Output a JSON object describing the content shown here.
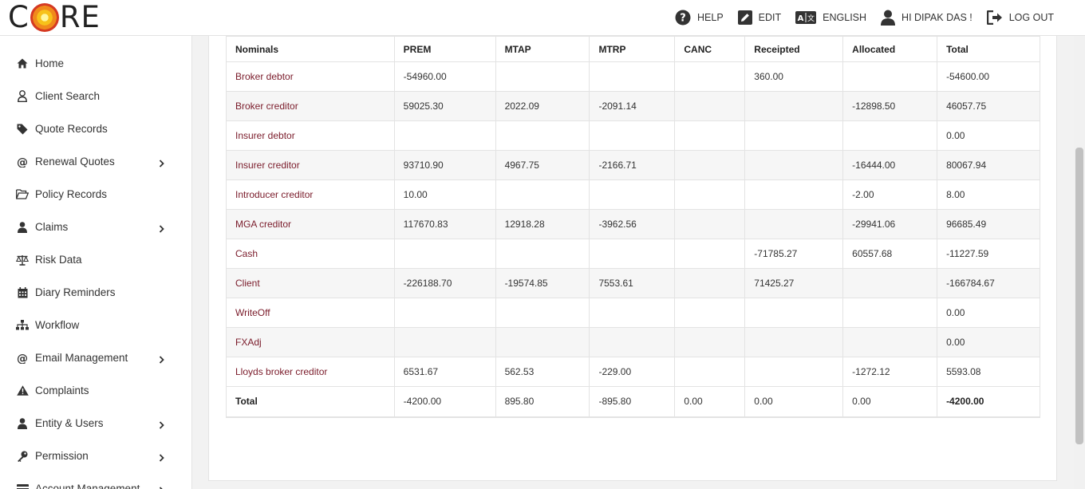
{
  "brand": {
    "left": "C",
    "right": "RE"
  },
  "topnav": [
    {
      "label": "HELP",
      "icon": "help-icon"
    },
    {
      "label": "EDIT",
      "icon": "edit-icon"
    },
    {
      "label": "ENGLISH",
      "icon": "translate-icon"
    },
    {
      "label": "HI DIPAK DAS !",
      "icon": "user-icon"
    },
    {
      "label": "LOG OUT",
      "icon": "logout-icon"
    }
  ],
  "sidebar": {
    "items": [
      {
        "label": "Home",
        "icon": "home-icon",
        "has_chevron": false
      },
      {
        "label": "Client Search",
        "icon": "user-outline-icon",
        "has_chevron": false
      },
      {
        "label": "Quote Records",
        "icon": "tag-icon",
        "has_chevron": false
      },
      {
        "label": "Renewal Quotes",
        "icon": "at-icon",
        "has_chevron": true
      },
      {
        "label": "Policy Records",
        "icon": "folder-open-icon",
        "has_chevron": false
      },
      {
        "label": "Claims",
        "icon": "user-icon",
        "has_chevron": true
      },
      {
        "label": "Risk Data",
        "icon": "scale-icon",
        "has_chevron": false
      },
      {
        "label": "Diary Reminders",
        "icon": "calendar-icon",
        "has_chevron": false
      },
      {
        "label": "Workflow",
        "icon": "sitemap-icon",
        "has_chevron": false
      },
      {
        "label": "Email Management",
        "icon": "at-icon",
        "has_chevron": true
      },
      {
        "label": "Complaints",
        "icon": "warning-icon",
        "has_chevron": false
      },
      {
        "label": "Entity & Users",
        "icon": "user-icon",
        "has_chevron": true
      },
      {
        "label": "Permission",
        "icon": "key-icon",
        "has_chevron": true
      },
      {
        "label": "Account Management",
        "icon": "credit-card-icon",
        "has_chevron": true
      }
    ]
  },
  "table": {
    "headers": [
      "Nominals",
      "PREM",
      "MTAP",
      "MTRP",
      "CANC",
      "Receipted",
      "Allocated",
      "Total"
    ],
    "rows": [
      [
        "Broker debtor",
        "-54960.00",
        "",
        "",
        "",
        "360.00",
        "",
        "-54600.00"
      ],
      [
        "Broker creditor",
        "59025.30",
        "2022.09",
        "-2091.14",
        "",
        "",
        "-12898.50",
        "46057.75"
      ],
      [
        "Insurer debtor",
        "",
        "",
        "",
        "",
        "",
        "",
        "0.00"
      ],
      [
        "Insurer creditor",
        "93710.90",
        "4967.75",
        "-2166.71",
        "",
        "",
        "-16444.00",
        "80067.94"
      ],
      [
        "Introducer creditor",
        "10.00",
        "",
        "",
        "",
        "",
        "-2.00",
        "8.00"
      ],
      [
        "MGA creditor",
        "117670.83",
        "12918.28",
        "-3962.56",
        "",
        "",
        "-29941.06",
        "96685.49"
      ],
      [
        "Cash",
        "",
        "",
        "",
        "",
        "-71785.27",
        "60557.68",
        "-11227.59"
      ],
      [
        "Client",
        "-226188.70",
        "-19574.85",
        "7553.61",
        "",
        "71425.27",
        "",
        "-166784.67"
      ],
      [
        "WriteOff",
        "",
        "",
        "",
        "",
        "",
        "",
        "0.00"
      ],
      [
        "FXAdj",
        "",
        "",
        "",
        "",
        "",
        "",
        "0.00"
      ],
      [
        "Lloyds broker creditor",
        "6531.67",
        "562.53",
        "-229.00",
        "",
        "",
        "-1272.12",
        "5593.08"
      ]
    ],
    "total": [
      "Total",
      "-4200.00",
      "895.80",
      "-895.80",
      "0.00",
      "0.00",
      "0.00",
      "-4200.00"
    ]
  }
}
